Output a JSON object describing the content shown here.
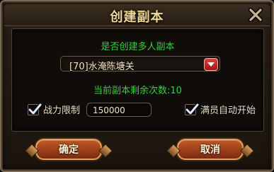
{
  "dialog": {
    "title": "创建副本",
    "close_icon": "close-icon"
  },
  "panel": {
    "question": "是否创建多人副本",
    "dungeon_select": {
      "selected": "[70]水淹陈塘关",
      "dropdown_icon": "chevron-down-icon"
    },
    "remaining_text": "当前副本剩余次数:10",
    "power_limit": {
      "checked": true,
      "label": "战力限制",
      "value": "150000"
    },
    "auto_start": {
      "checked": true,
      "label": "满员自动开始"
    }
  },
  "buttons": {
    "confirm_label": "确定",
    "cancel_label": "取消"
  },
  "colors": {
    "accent_green": "#35d63a",
    "button_orange": "#c05a25",
    "dropdown_red": "#e04040",
    "title_gold": "#f0d89a"
  }
}
